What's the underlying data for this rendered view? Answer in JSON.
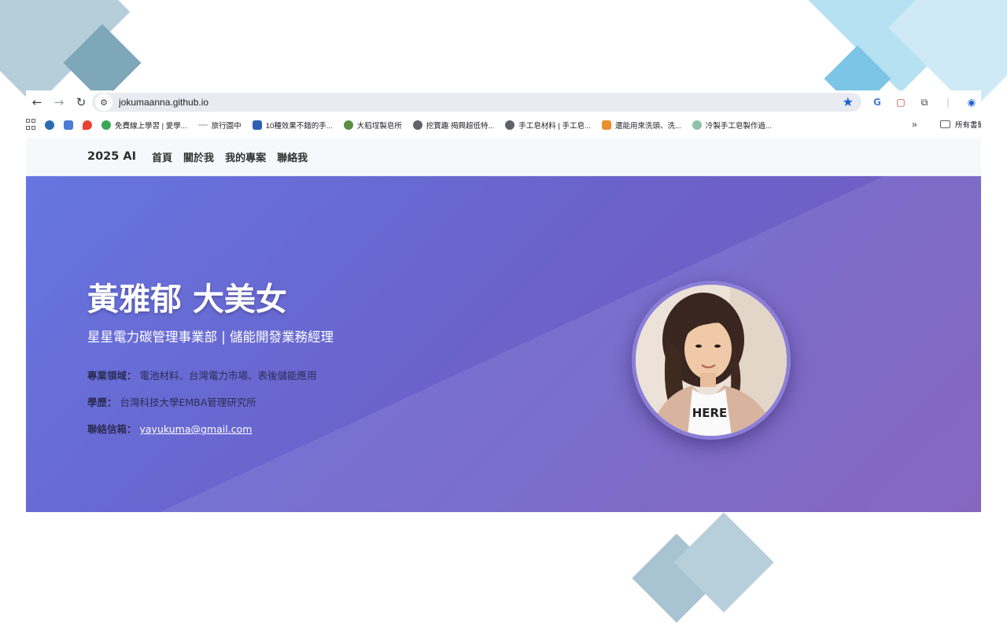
{
  "browser": {
    "url": "jokumaanna.github.io",
    "bookmarks": [
      {
        "label": "免費線上學習 | 愛學...",
        "color": "#3aa757"
      },
      {
        "label": "旅行園中",
        "color": "#9aa0a6"
      },
      {
        "label": "10種效果不錯的手...",
        "color": "#2f5fb3"
      },
      {
        "label": "大稻埕製皂所",
        "color": "#5b8f47"
      },
      {
        "label": "挖寶趣 揭興超低特...",
        "color": "#5f6368"
      },
      {
        "label": "手工皂材料 | 手工皂...",
        "color": "#5f6368"
      },
      {
        "label": "還能用來洗頭、洗...",
        "color": "#e8912d"
      },
      {
        "label": "冷製手工皂製作過...",
        "color": "#8fc3a9"
      }
    ],
    "bookmarks_more": "»",
    "all_bookmarks": "所有書籤"
  },
  "site": {
    "brand": "2025 AI",
    "nav": [
      "首頁",
      "關於我",
      "我的專案",
      "聯絡我"
    ]
  },
  "hero": {
    "title": "黃雅郁 大美女",
    "subtitle": "星星電力碳管理事業部 | 儲能開發業務經理",
    "expertise_label": "專業領域：",
    "expertise_value": "電池材料、台灣電力市場、表後儲能應用",
    "education_label": "學歷：",
    "education_value": "台灣科技大學EMBA管理研究所",
    "email_label": "聯絡信箱：",
    "email_value": "yayukuma@gmail.com",
    "photo_shirt_text": "HERE"
  },
  "colors": {
    "hero_gradient": [
      "#6676e0",
      "#6a63cc",
      "#7a58ba"
    ],
    "star": "#1a5fd4"
  },
  "icons": [
    "back-icon",
    "forward-icon",
    "reload-icon",
    "site-info-icon",
    "bookmark-star-icon",
    "translate-icon",
    "extension-icon",
    "profile-icon",
    "apps-grid-icon",
    "folder-icon"
  ]
}
